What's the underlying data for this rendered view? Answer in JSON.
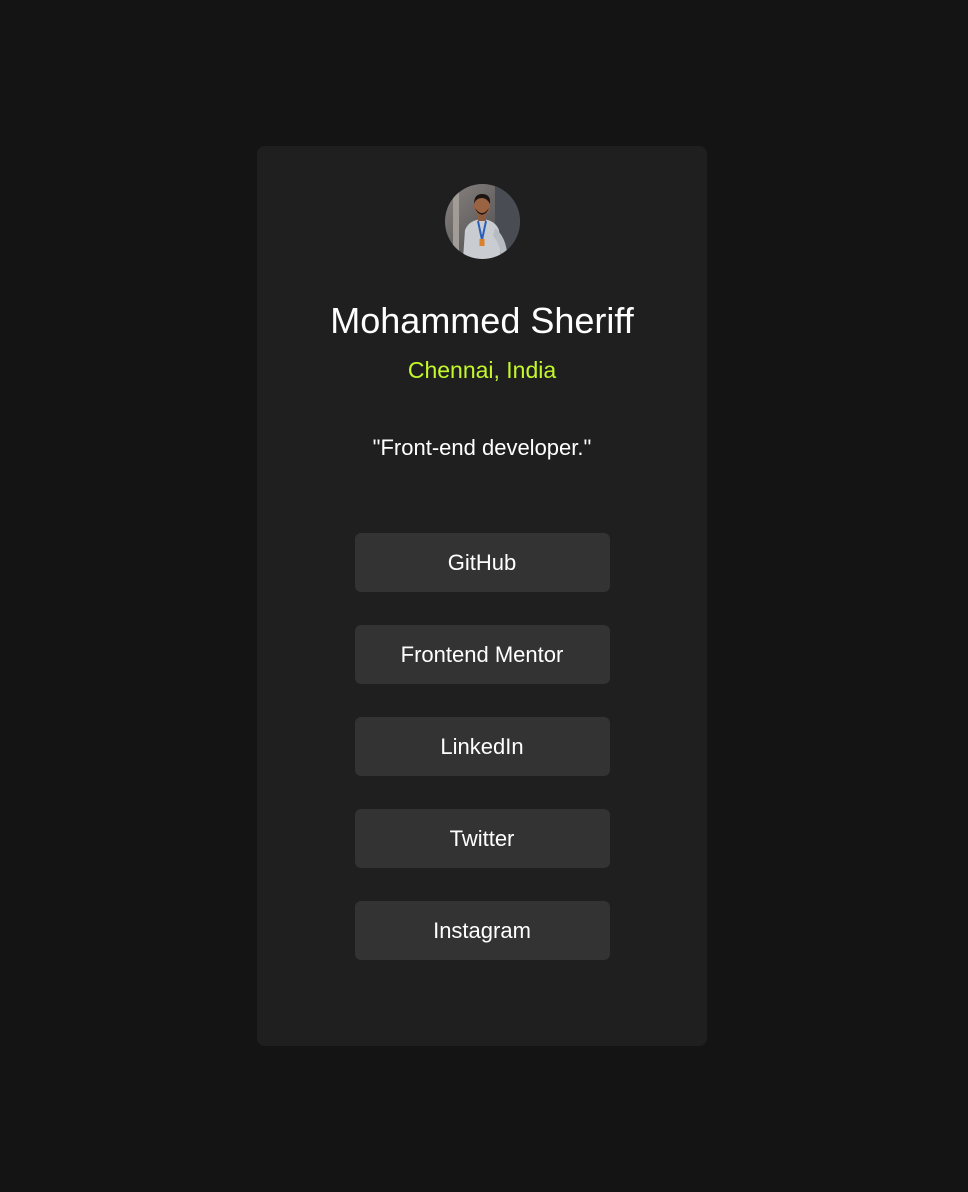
{
  "profile": {
    "name": "Mohammed Sheriff",
    "location": "Chennai, India",
    "bio": "\"Front-end developer.\""
  },
  "links": [
    {
      "label": "GitHub"
    },
    {
      "label": "Frontend Mentor"
    },
    {
      "label": "LinkedIn"
    },
    {
      "label": "Twitter"
    },
    {
      "label": "Instagram"
    }
  ],
  "colors": {
    "page_background": "#141414",
    "card_background": "#1f1f1f",
    "button_background": "#333333",
    "accent": "#c4f82a",
    "text": "#ffffff"
  }
}
